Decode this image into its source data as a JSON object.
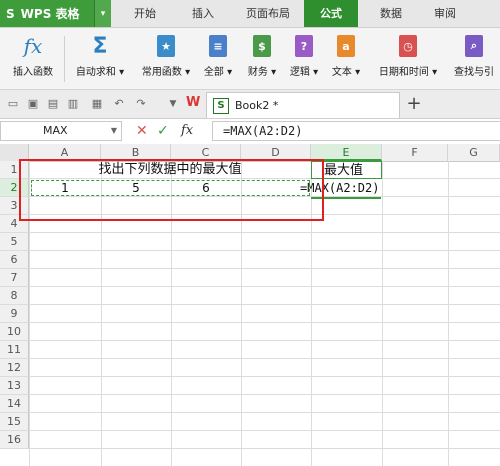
{
  "app": {
    "name": "WPS 表格",
    "logo": "S"
  },
  "tabs": [
    "开始",
    "插入",
    "页面布局",
    "公式",
    "数据",
    "审阅"
  ],
  "active_tab": "公式",
  "ribbon": [
    {
      "label": "插入函数",
      "icon": "fx-icon"
    },
    {
      "label": "自动求和 ▾",
      "icon": "sigma-icon"
    },
    {
      "label": "常用函数 ▾",
      "icon": "star-book-icon"
    },
    {
      "label": "全部 ▾",
      "icon": "list-book-icon"
    },
    {
      "label": "财务 ▾",
      "icon": "finance-book-icon"
    },
    {
      "label": "逻辑 ▾",
      "icon": "logic-book-icon"
    },
    {
      "label": "文本 ▾",
      "icon": "text-book-icon"
    },
    {
      "label": "日期和时间 ▾",
      "icon": "clock-book-icon"
    },
    {
      "label": "查找与引",
      "icon": "search-book-icon"
    }
  ],
  "ribbon_glyphs": [
    "fx",
    "Σ",
    "★",
    "≡",
    "$",
    "?",
    "a",
    "◷",
    "⌕"
  ],
  "ribbon_colors": [
    "#2a7fc1",
    "#2a7fc1",
    "#3a8dc9",
    "#4a7fc9",
    "#4a9a4a",
    "#9a5bc4",
    "#e8892b",
    "#d95252",
    "#7a5bc4"
  ],
  "doc_tab": "Book2 *",
  "name_box": "MAX",
  "formula": "=MAX(A2:D2)",
  "columns": [
    "A",
    "B",
    "C",
    "D",
    "E",
    "F",
    "G"
  ],
  "rows": [
    "1",
    "2",
    "3",
    "4",
    "5",
    "6",
    "7",
    "8",
    "9",
    "10",
    "11",
    "12",
    "13",
    "14",
    "15",
    "16"
  ],
  "cells": {
    "A1": "找出下列数据中的最大值",
    "E1": "最大值",
    "A2": "1",
    "B2": "5",
    "C2": "6",
    "E2": "=MAX(A2:D2)"
  },
  "colors": {
    "brand": "#3e9c3a",
    "highlight": "#e02020",
    "range_border": "#3b9a3b"
  }
}
